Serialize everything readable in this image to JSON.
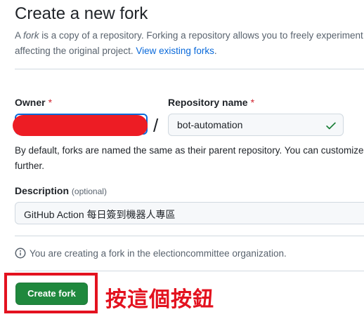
{
  "header": {
    "title": "Create a new fork"
  },
  "intro": {
    "prefix": "A ",
    "fork_word": "fork",
    "line1_rest": " is a copy of a repository. Forking a repository allows you to freely experiment",
    "line2_text": "affecting the original project. ",
    "link": "View existing forks",
    "line2_end": "."
  },
  "owner": {
    "label": "Owner",
    "required_mark": "*"
  },
  "separator": "/",
  "repository": {
    "label": "Repository name",
    "required_mark": "*",
    "value": "bot-automation"
  },
  "help": {
    "line1": "By default, forks are named the same as their parent repository. You can customize",
    "line2": "further."
  },
  "description": {
    "label": "Description",
    "optional": "(optional)",
    "value": "GitHub Action 每日簽到機器人專區"
  },
  "info": {
    "text": "You are creating a fork in the electioncommittee organization."
  },
  "actions": {
    "create_label": "Create fork"
  },
  "annotation": {
    "text": "按這個按鈕"
  },
  "colors": {
    "primary_button": "#1f883d",
    "link": "#0969da",
    "required": "#d1242f",
    "check": "#1a7f37",
    "annotation": "#e3121f",
    "redaction": "#ed1c24"
  },
  "icons": {
    "check": "check-icon",
    "info": "info-icon"
  }
}
